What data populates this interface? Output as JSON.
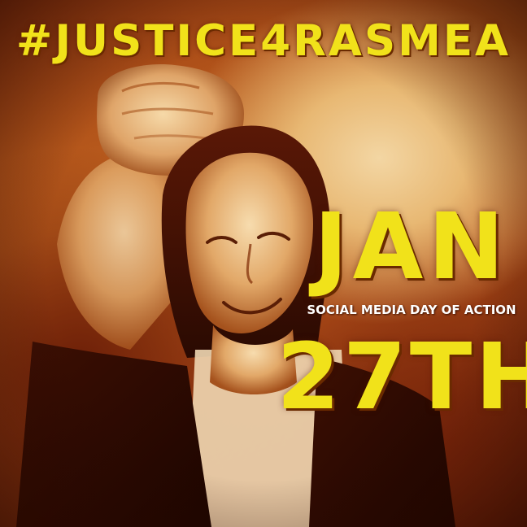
{
  "poster": {
    "hashtag": "#JUSTICE4RASMEA",
    "month": "JAN",
    "subtitle": "SOCIAL MEDIA DAY OF ACTION",
    "day": "27TH"
  },
  "colors": {
    "headline_yellow": "#f1e21a",
    "subtitle_white": "#ffffff",
    "sepia_dark": "#6b1e07",
    "sepia_mid": "#c0621f",
    "sepia_light": "#f3d6a3"
  }
}
